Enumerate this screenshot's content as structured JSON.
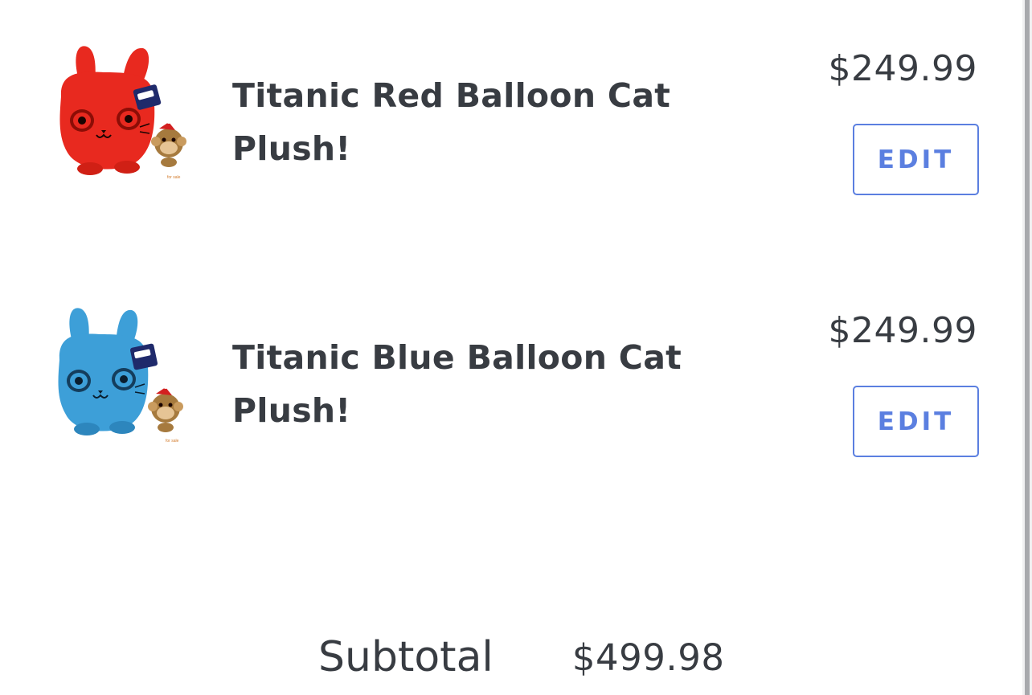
{
  "cart": {
    "items": [
      {
        "title": "Titanic Red Balloon Cat Plush!",
        "price": "$249.99",
        "edit_label": "EDIT",
        "image_color": "#e8291f",
        "image_icon": "red-balloon-cat-plush-icon"
      },
      {
        "title": "Titanic Blue Balloon Cat Plush!",
        "price": "$249.99",
        "edit_label": "EDIT",
        "image_color": "#3d9fd8",
        "image_icon": "blue-balloon-cat-plush-icon"
      }
    ],
    "subtotal_label": "Subtotal",
    "subtotal_value": "$499.98"
  },
  "colors": {
    "accent": "#5b7fe0",
    "text": "#383c42"
  }
}
